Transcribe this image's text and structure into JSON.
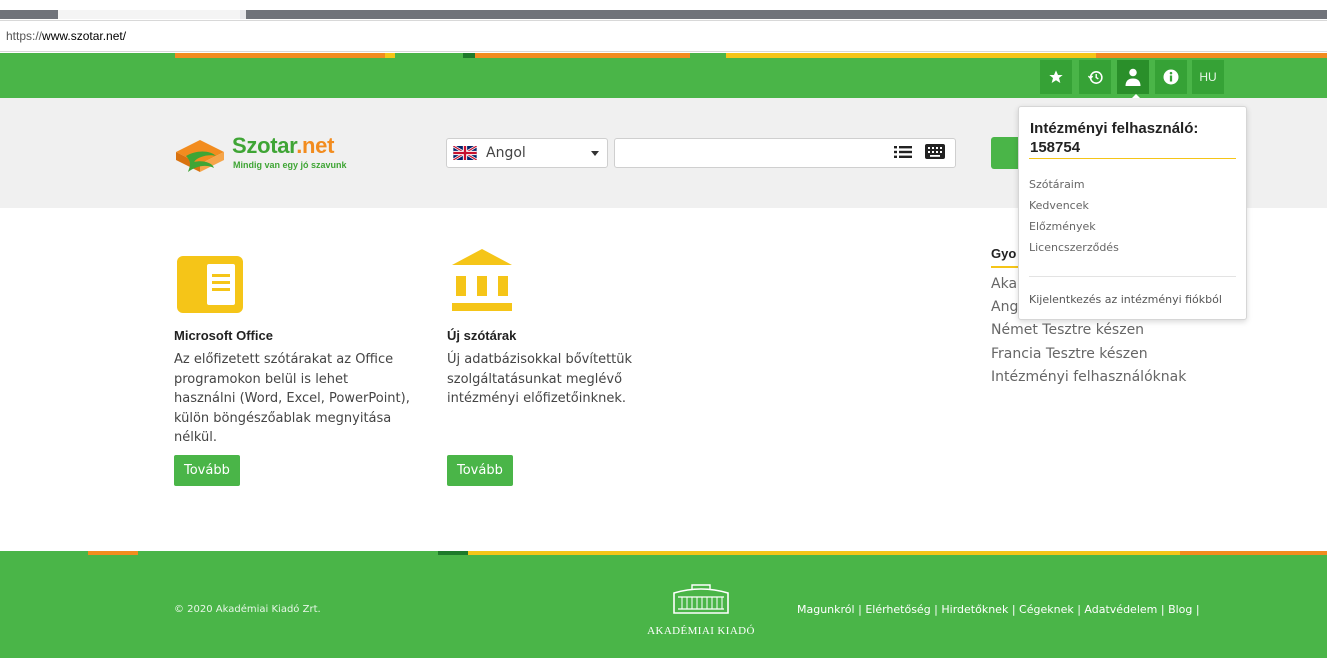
{
  "browser": {
    "url_prefix": "https://",
    "url_domain": "www.szotar.net/"
  },
  "topbar": {
    "favorites_icon": "star-icon",
    "history_icon": "history-icon",
    "user_icon": "user-icon",
    "info_icon": "info-icon",
    "language": "HU"
  },
  "brand": {
    "name_main": "Szotar",
    "name_suffix": ".net",
    "tagline": "Mindig van egy jó szavunk"
  },
  "search": {
    "language": "Angol",
    "query": "",
    "list_icon": "list-icon",
    "keyboard_icon": "keyboard-icon"
  },
  "user_menu": {
    "title": "Intézményi felhasználó: 158754",
    "items": [
      "Szótáraim",
      "Kedvencek",
      "Előzmények",
      "Licencszerződés"
    ],
    "logout": "Kijelentkezés az intézményi fiókból"
  },
  "features": [
    {
      "icon": "document-icon",
      "title": "Microsoft Office",
      "lines": [
        "Az előfizetett szótárakat az Office",
        "programokon belül is lehet",
        "használni (Word, Excel, PowerPoint),",
        "külön böngészőablak megnyitása",
        "nélkül."
      ],
      "button": "Tovább"
    },
    {
      "icon": "institution-icon",
      "title": "Új szótárak",
      "lines": [
        "Új adatbázisokkal bővítettük",
        "szolgáltatásunkat meglévő",
        "intézményi előfizetőinknek."
      ],
      "button": "Tovább"
    }
  ],
  "quick_links": {
    "title": "Gyo",
    "items": [
      "Aka",
      "Ang",
      "Német Tesztre készen",
      "Francia Tesztre készen",
      "Intézményi felhasználóknak"
    ]
  },
  "footer": {
    "copyright": "© 2020 Akadémiai Kiadó Zrt.",
    "publisher": "AKADÉMIAI KIADÓ",
    "links": [
      "Magunkról",
      "Elérhetőség",
      "Hirdetőknek",
      "Cégeknek",
      "Adatvédelem",
      "Blog"
    ]
  },
  "colors": {
    "green": "#4ab548",
    "dark_green": "#36a236",
    "yellow": "#f5c518",
    "orange": "#f28c1f"
  }
}
